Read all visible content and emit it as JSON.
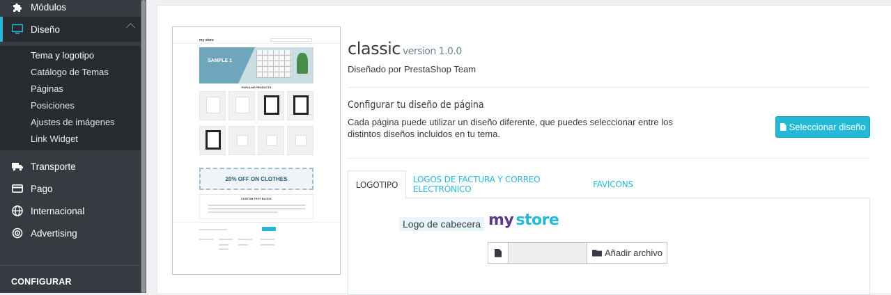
{
  "sidebar": {
    "items_top": [
      {
        "label": "Módulos",
        "icon": "puzzle-icon"
      },
      {
        "label": "Diseño",
        "icon": "monitor-icon"
      }
    ],
    "sub_items": [
      {
        "label": "Tema y logotipo"
      },
      {
        "label": "Catálogo de Temas"
      },
      {
        "label": "Páginas"
      },
      {
        "label": "Posiciones"
      },
      {
        "label": "Ajustes de imágenes"
      },
      {
        "label": "Link Widget"
      }
    ],
    "items_bottom": [
      {
        "label": "Transporte",
        "icon": "truck-icon"
      },
      {
        "label": "Pago",
        "icon": "credit-card-icon"
      },
      {
        "label": "Internacional",
        "icon": "globe-icon"
      },
      {
        "label": "Advertising",
        "icon": "target-icon"
      }
    ],
    "section_label": "CONFIGURAR"
  },
  "theme": {
    "name": "classic",
    "version": "version 1.0.0",
    "author": "Diseñado por PrestaShop Team"
  },
  "layout_section": {
    "title": "Configurar tu diseño de página",
    "description": "Cada página puede utilizar un diseño diferente, que puedes seleccionar entre los distintos diseños incluidos en tu tema.",
    "button_label": "Seleccionar diseño"
  },
  "tabs": [
    {
      "label": "LOGOTIPO",
      "active": true
    },
    {
      "label": "LOGOS DE FACTURA Y CORREO ELECTRÓNICO",
      "active": false
    },
    {
      "label": "FAVICONS",
      "active": false
    }
  ],
  "logo_tab": {
    "header_logo_label": "Logo de cabecera",
    "logo_text": {
      "part1": "my",
      "part2": "store"
    },
    "file_button_label": "Añadir archivo"
  },
  "preview": {
    "hero_text": "SAMPLE 1",
    "section_title": "POPULAR PRODUCTS",
    "banner_text": "20% OFF ON CLOTHES",
    "block_title": "CUSTOM TEXT BLOCK"
  },
  "colors": {
    "accent": "#25b9d7",
    "sidebar_bg": "#363a41",
    "sidebar_active_bg": "#282b30"
  }
}
